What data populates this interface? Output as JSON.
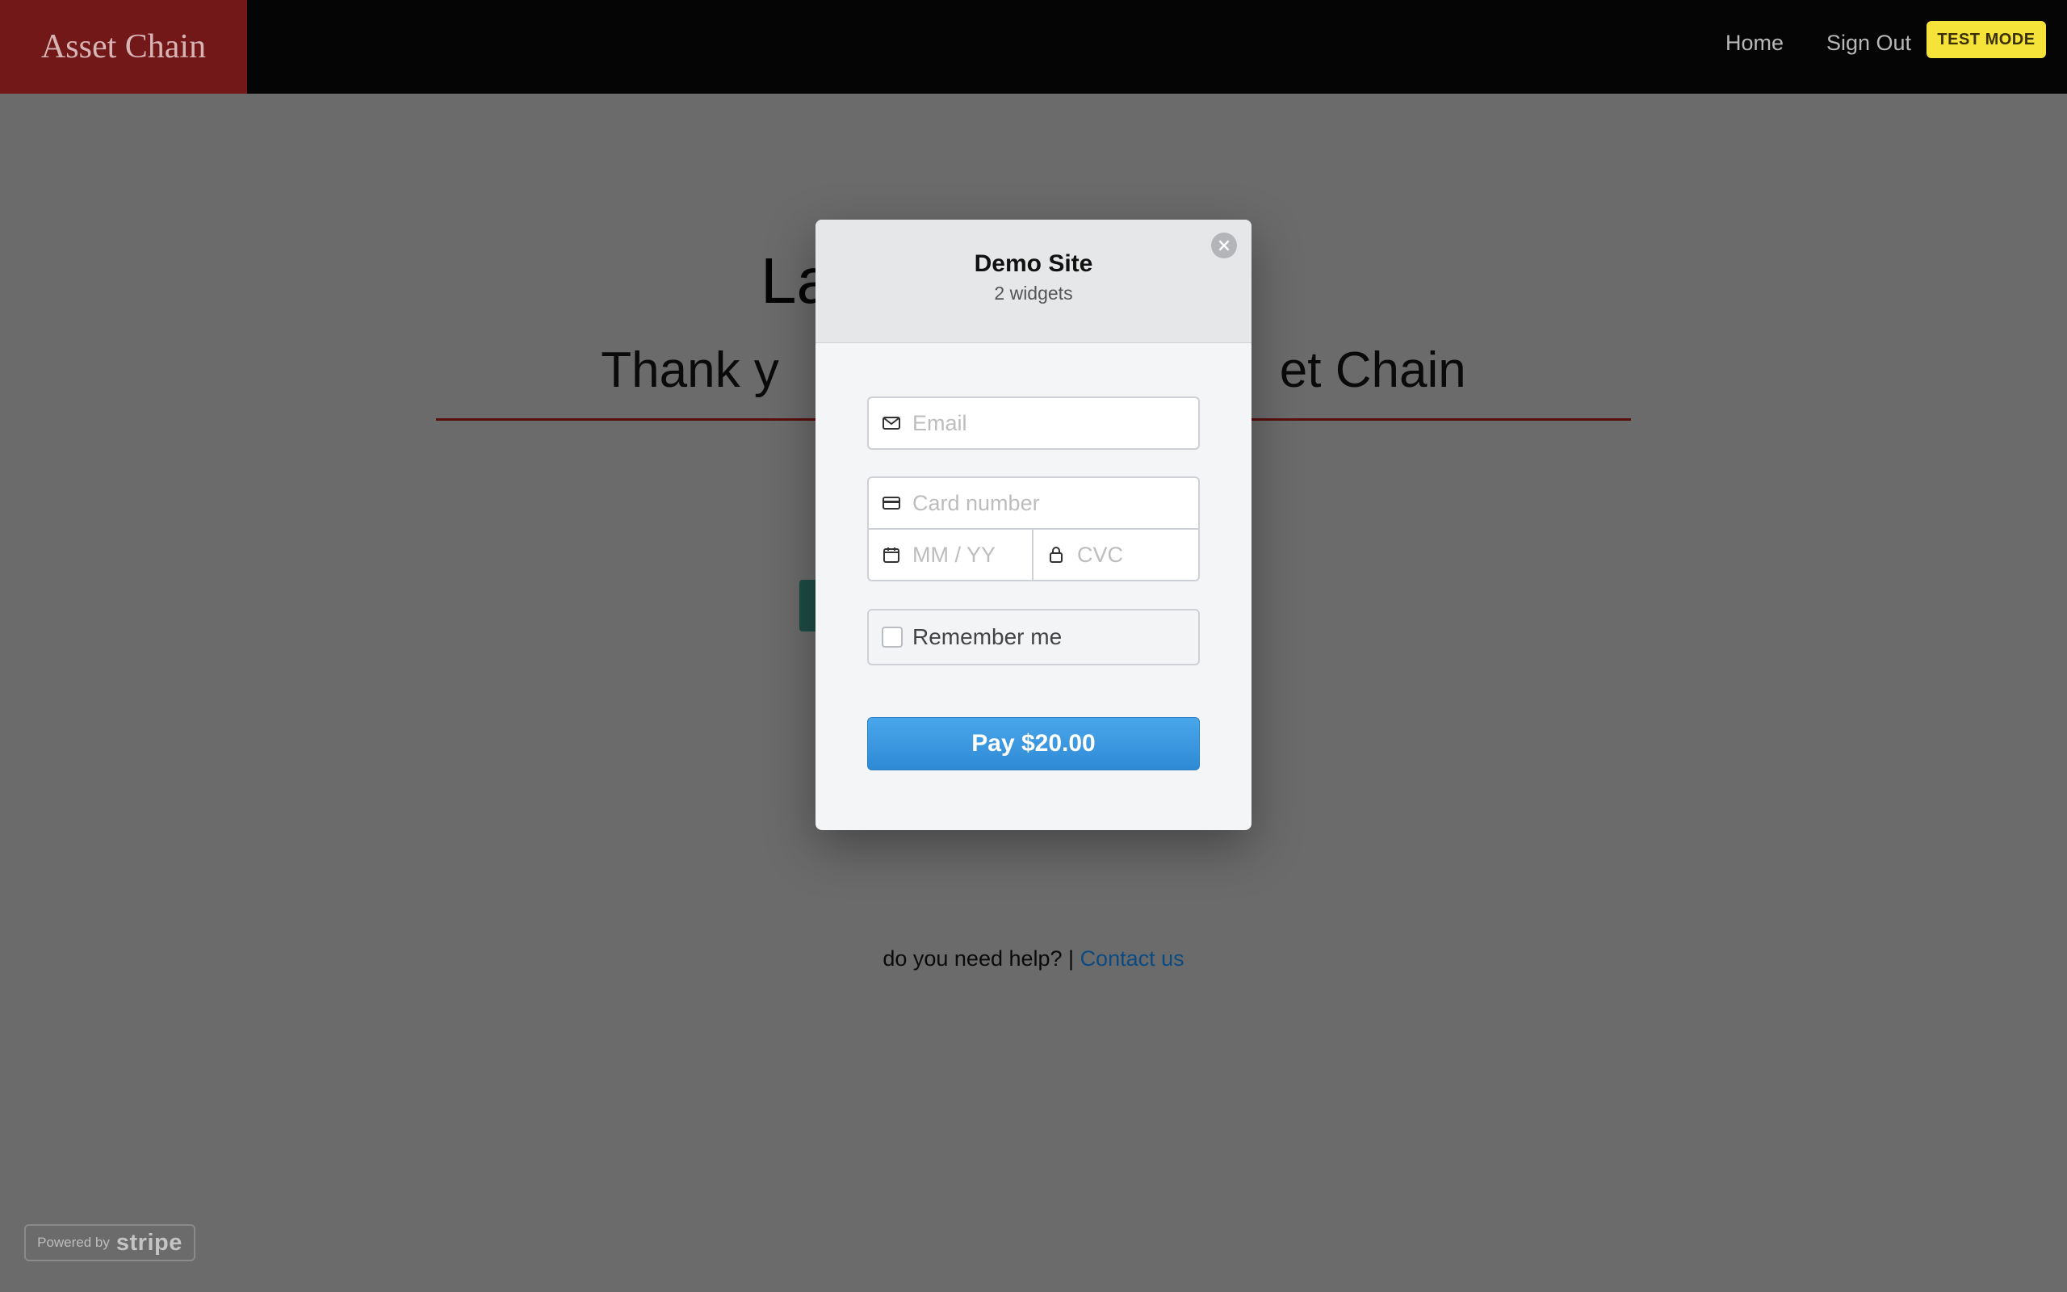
{
  "navbar": {
    "brand": "Asset Chain",
    "links": [
      {
        "label": "Home"
      },
      {
        "label": "Sign Out"
      }
    ]
  },
  "page": {
    "heading_visible": "La",
    "subtitle_left": "Thank y",
    "subtitle_right": "et Chain",
    "help_text": "do you need help? | ",
    "help_link": "Contact us"
  },
  "checkout": {
    "test_mode_label": "TEST MODE",
    "title": "Demo Site",
    "subtitle": "2 widgets",
    "email_placeholder": "Email",
    "card_placeholder": "Card number",
    "expiry_placeholder": "MM / YY",
    "cvc_placeholder": "CVC",
    "remember_label": "Remember me",
    "remember_checked": false,
    "pay_label": "Pay $20.00",
    "icons": [
      "close-icon",
      "envelope-icon",
      "credit-card-icon",
      "calendar-icon",
      "lock-icon"
    ]
  },
  "powered_by": {
    "prefix": "Powered by",
    "brand": "stripe"
  },
  "colors": {
    "navbar_bg": "#050505",
    "brand_bg": "#721818",
    "overlay_bg": "#6b6b6b",
    "pay_button": "#3596e0",
    "test_badge": "#f5e33a"
  }
}
